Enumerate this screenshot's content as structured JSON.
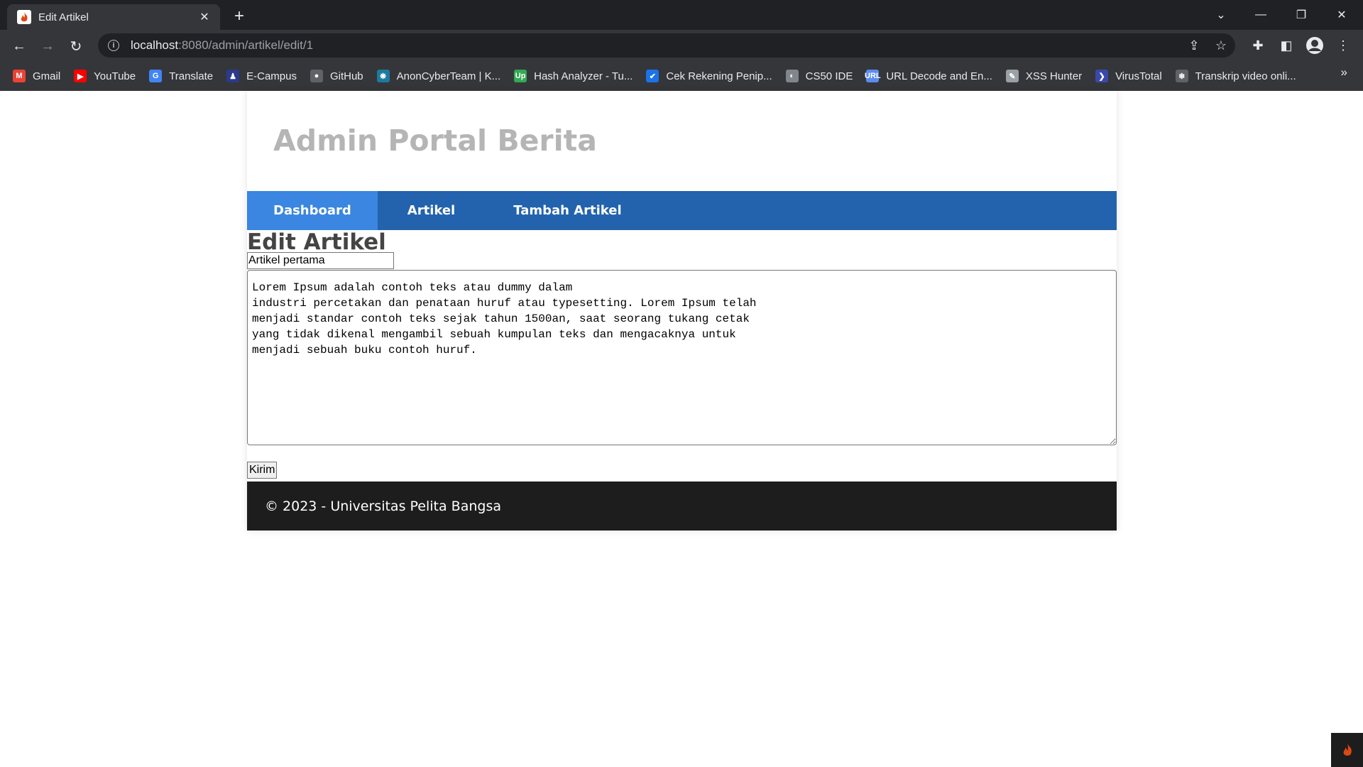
{
  "browser": {
    "tab_title": "Edit Artikel",
    "url_host": "localhost",
    "url_path": ":8080/admin/artikel/edit/1"
  },
  "bookmarks": [
    {
      "label": "Gmail",
      "icon": "gmail-icon",
      "color": "#ea4335",
      "glyph": "M"
    },
    {
      "label": "YouTube",
      "icon": "youtube-icon",
      "color": "#ff0000",
      "glyph": "▶"
    },
    {
      "label": "Translate",
      "icon": "translate-icon",
      "color": "#4285f4",
      "glyph": "G"
    },
    {
      "label": "E-Campus",
      "icon": "ecampus-icon",
      "color": "#2b3a8c",
      "glyph": "♟"
    },
    {
      "label": "GitHub",
      "icon": "github-icon",
      "color": "#5f6368",
      "glyph": "●"
    },
    {
      "label": "AnonCyberTeam | K...",
      "icon": "anoncyberteam-icon",
      "color": "#1d7a9e",
      "glyph": "❋"
    },
    {
      "label": "Hash Analyzer - Tu...",
      "icon": "hash-analyzer-icon",
      "color": "#34a853",
      "glyph": "Up"
    },
    {
      "label": "Cek Rekening Penip...",
      "icon": "cek-rekening-icon",
      "color": "#1a73e8",
      "glyph": "✔"
    },
    {
      "label": "CS50 IDE",
      "icon": "cs50-icon",
      "color": "#80868b",
      "glyph": "◐"
    },
    {
      "label": "URL Decode and En...",
      "icon": "url-decode-icon",
      "color": "#5b8def",
      "glyph": "URL"
    },
    {
      "label": "XSS Hunter",
      "icon": "xss-hunter-icon",
      "color": "#9aa0a6",
      "glyph": "✎"
    },
    {
      "label": "VirusTotal",
      "icon": "virustotal-icon",
      "color": "#3949ab",
      "glyph": "❯"
    },
    {
      "label": "Transkrip video onli...",
      "icon": "transkrip-icon",
      "color": "#5f6368",
      "glyph": "❄"
    }
  ],
  "site": {
    "title": "Admin Portal Berita",
    "nav": [
      "Dashboard",
      "Artikel",
      "Tambah Artikel"
    ],
    "footer": "© 2023 - Universitas Pelita Bangsa"
  },
  "form": {
    "heading": "Edit Artikel",
    "title_value": "Artikel pertama",
    "body_value": "Lorem Ipsum adalah contoh teks atau dummy dalam\nindustri percetakan dan penataan huruf atau typesetting. Lorem Ipsum telah\nmenjadi standar contoh teks sejak tahun 1500an, saat seorang tukang cetak\nyang tidak dikenal mengambil sebuah kumpulan teks dan mengacaknya untuk\nmenjadi sebuah buku contoh huruf.",
    "submit_label": "Kirim"
  },
  "colors": {
    "navbar": "#2363ad",
    "nav_active": "#3a86e0",
    "footer": "#1d1d1d",
    "site_title": "#b5b5b5"
  }
}
